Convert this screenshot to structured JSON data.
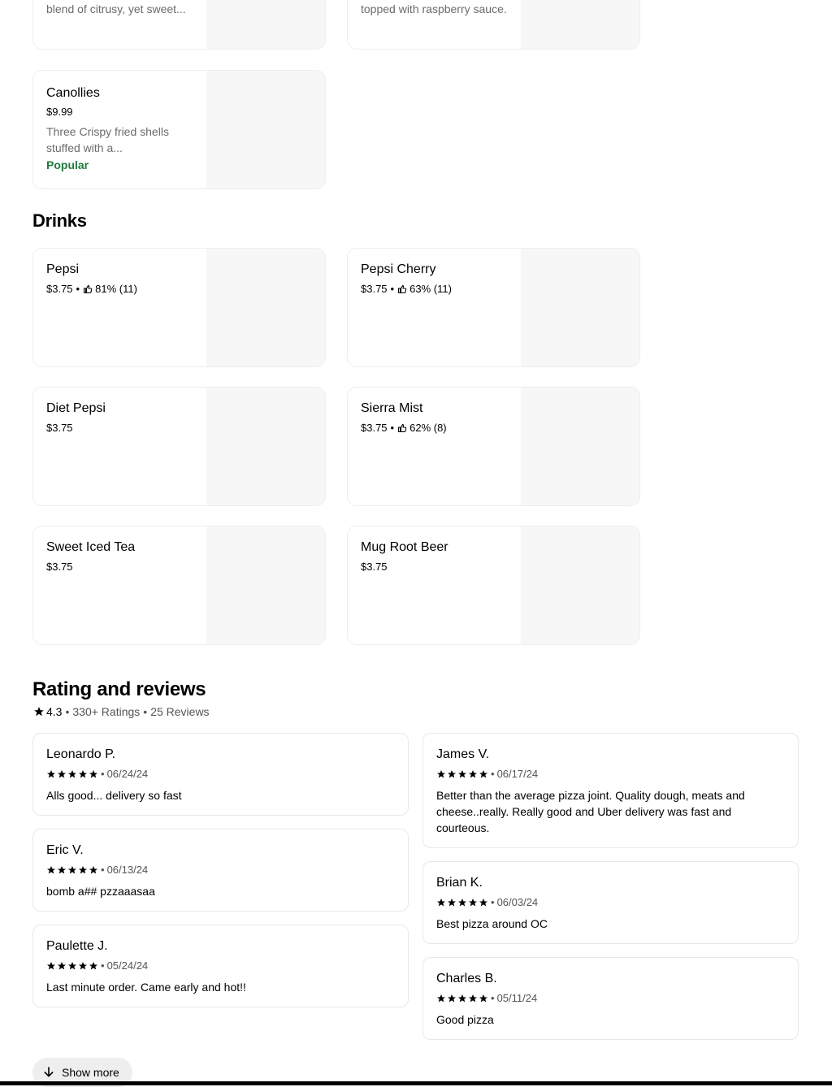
{
  "desserts_partial": [
    {
      "desc": "blend of citrusy, yet sweet..."
    },
    {
      "desc": "topped with raspberry sauce."
    }
  ],
  "canollies": {
    "name": "Canollies",
    "price": "$9.99",
    "desc": "Three Crispy fried shells stuffed with a...",
    "badge": "Popular"
  },
  "drinks": {
    "title": "Drinks",
    "items": [
      {
        "name": "Pepsi",
        "price": "$3.75",
        "rating": "81% (11)"
      },
      {
        "name": "Pepsi Cherry",
        "price": "$3.75",
        "rating": "63% (11)"
      },
      {
        "name": "Diet Pepsi",
        "price": "$3.75"
      },
      {
        "name": "Sierra Mist",
        "price": "$3.75",
        "rating": "62% (8)"
      },
      {
        "name": "Sweet Iced Tea",
        "price": "$3.75"
      },
      {
        "name": "Mug Root Beer",
        "price": "$3.75"
      }
    ]
  },
  "reviews": {
    "title": "Rating and reviews",
    "rating": "4.3",
    "ratings_count": "330+ Ratings",
    "reviews_count": "25 Reviews",
    "left": [
      {
        "name": "Leonardo P.",
        "date": "06/24/24",
        "text": "Alls good... delivery so fast",
        "stars": 5
      },
      {
        "name": "Eric V.",
        "date": "06/13/24",
        "text": "bomb a## pzzaaasaa",
        "stars": 5
      },
      {
        "name": "Paulette J.",
        "date": "05/24/24",
        "text": "Last minute order. Came early and hot!!",
        "stars": 5
      }
    ],
    "right": [
      {
        "name": "James V.",
        "date": "06/17/24",
        "text": "Better than the average pizza joint. Quality dough, meats and cheese..really. Really good and Uber delivery was fast and courteous.",
        "stars": 5
      },
      {
        "name": "Brian K.",
        "date": "06/03/24",
        "text": "Best pizza around OC",
        "stars": 5
      },
      {
        "name": "Charles B.",
        "date": "05/11/24",
        "text": "Good pizza",
        "stars": 5
      }
    ],
    "show_more": "Show more"
  },
  "icons": {
    "thumb": "thumbs-up-icon",
    "star": "star-icon",
    "arrow": "arrow-down-icon"
  },
  "colors": {
    "popular": "#1f7a3d",
    "image_placeholder": "#f7f7f7"
  }
}
